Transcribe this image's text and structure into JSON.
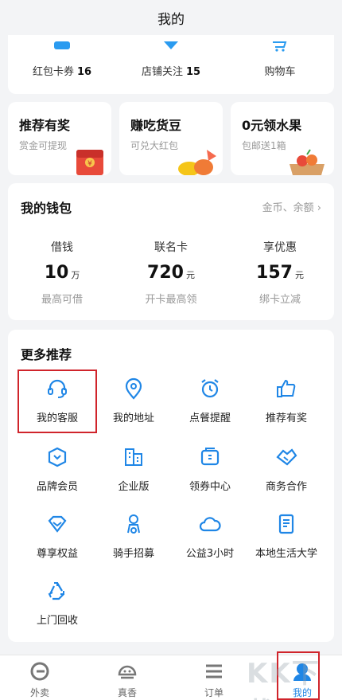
{
  "header": {
    "title": "我的"
  },
  "stats": [
    {
      "label": "红包卡券",
      "value": "16"
    },
    {
      "label": "店铺关注",
      "value": "15"
    },
    {
      "label": "购物车",
      "value": ""
    }
  ],
  "promos": [
    {
      "title": "推荐有奖",
      "subtitle": "赏金可提现",
      "icon": "red-envelope-icon"
    },
    {
      "title": "赚吃货豆",
      "subtitle": "可兑大红包",
      "icon": "beans-icon"
    },
    {
      "title": "0元领水果",
      "subtitle": "包邮送1箱",
      "icon": "fruit-box-icon"
    }
  ],
  "wallet": {
    "title": "我的钱包",
    "link": "金币、余额 ›",
    "columns": [
      {
        "label": "借钱",
        "value": "10",
        "unit": "万",
        "desc": "最高可借"
      },
      {
        "label": "联名卡",
        "value": "720",
        "unit": "元",
        "desc": "开卡最高领"
      },
      {
        "label": "享优惠",
        "value": "157",
        "unit": "元",
        "desc": "绑卡立减"
      }
    ]
  },
  "more": {
    "title": "更多推荐",
    "items": [
      {
        "label": "我的客服",
        "icon": "headset-icon"
      },
      {
        "label": "我的地址",
        "icon": "location-pin-icon"
      },
      {
        "label": "点餐提醒",
        "icon": "alarm-clock-icon"
      },
      {
        "label": "推荐有奖",
        "icon": "thumbs-up-icon"
      },
      {
        "label": "品牌会员",
        "icon": "shield-badge-icon"
      },
      {
        "label": "企业版",
        "icon": "building-icon"
      },
      {
        "label": "领券中心",
        "icon": "coupon-icon"
      },
      {
        "label": "商务合作",
        "icon": "handshake-icon"
      },
      {
        "label": "尊享权益",
        "icon": "diamond-icon"
      },
      {
        "label": "骑手招募",
        "icon": "rider-icon"
      },
      {
        "label": "公益3小时",
        "icon": "cloud-icon"
      },
      {
        "label": "本地生活大学",
        "icon": "book-icon"
      },
      {
        "label": "上门回收",
        "icon": "recycle-icon"
      }
    ]
  },
  "nav": [
    {
      "label": "外卖",
      "icon": "takeout-icon"
    },
    {
      "label": "真香",
      "icon": "rice-bowl-icon"
    },
    {
      "label": "订单",
      "icon": "order-list-icon"
    },
    {
      "label": "我的",
      "icon": "profile-icon",
      "active": true
    }
  ],
  "watermark": "KK下载",
  "colors": {
    "accent": "#1f86e6",
    "highlight": "#d0242b"
  }
}
